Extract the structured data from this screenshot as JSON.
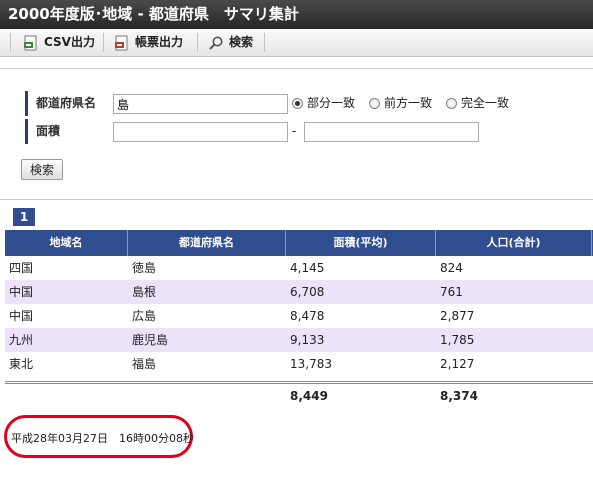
{
  "window": {
    "title": "2000年度版･地域 - 都道府県　サマリ集計"
  },
  "toolbar": {
    "csv_label": "CSV出力",
    "report_label": "帳票出力",
    "search_label": "検索"
  },
  "search": {
    "prefecture_label": "都道府県名",
    "prefecture_value": "島",
    "match_options": [
      "部分一致",
      "前方一致",
      "完全一致"
    ],
    "match_selected": "部分一致",
    "area_label": "面積",
    "area_from": "",
    "area_separator": "-",
    "area_to": "",
    "button_label": "検索"
  },
  "pagination": {
    "current_page": "1"
  },
  "table": {
    "headers": [
      "地域名",
      "都道府県名",
      "面積(平均)",
      "人口(合計)"
    ],
    "rows": [
      [
        "四国",
        "徳島",
        "4,145",
        "824"
      ],
      [
        "中国",
        "島根",
        "6,708",
        "761"
      ],
      [
        "中国",
        "広島",
        "8,478",
        "2,877"
      ],
      [
        "九州",
        "鹿児島",
        "9,133",
        "1,785"
      ],
      [
        "東北",
        "福島",
        "13,783",
        "2,127"
      ]
    ],
    "totals": [
      "",
      "",
      "8,449",
      "8,374"
    ]
  },
  "footer": {
    "timestamp": "平成28年03月27日　16時00分08秒"
  },
  "colors": {
    "header_bg": "#2f4d8f",
    "row_alt": "#ece3fb",
    "highlight_ring": "#e2001a"
  }
}
